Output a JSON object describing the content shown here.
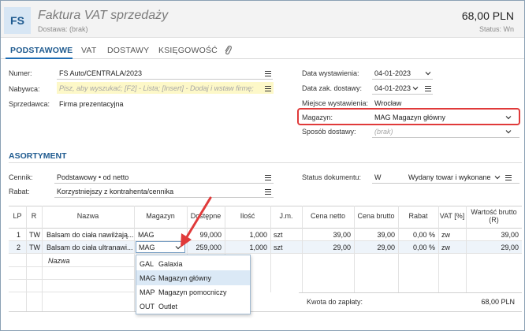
{
  "header": {
    "badge": "FS",
    "title": "Faktura VAT sprzedaży",
    "subtitle": "Dostawa: (brak)",
    "total": "68,00 PLN",
    "status": "Status: Wn"
  },
  "tabs": [
    {
      "label": "PODSTAWOWE",
      "active": true
    },
    {
      "label": "VAT"
    },
    {
      "label": "DOSTAWY"
    },
    {
      "label": "KSIĘGOWOŚĆ"
    }
  ],
  "form": {
    "numer_label": "Numer:",
    "numer_value": "FS Auto/CENTRALA/2023",
    "nabywca_label": "Nabywca:",
    "nabywca_placeholder": "Pisz, aby wyszukać; [F2] - Lista; [Insert] - Dodaj i wstaw firmę;",
    "sprzedawca_label": "Sprzedawca:",
    "sprzedawca_value": "Firma prezentacyjna",
    "data_wyst_label": "Data wystawienia:",
    "data_wyst_value": "04-01-2023",
    "data_zak_label": "Data zak. dostawy:",
    "data_zak_value": "04-01-2023",
    "miejsce_label": "Miejsce wystawienia:",
    "miejsce_value": "Wrocław",
    "magazyn_label": "Magazyn:",
    "magazyn_value": "MAG Magazyn główny",
    "sposob_label": "Sposób dostawy:",
    "sposob_value": "(brak)"
  },
  "asortyment": {
    "title": "ASORTYMENT",
    "cennik_label": "Cennik:",
    "cennik_value": "Podstawowy • od netto",
    "rabat_label": "Rabat:",
    "rabat_value": "Korzystniejszy z kontrahenta/cennika",
    "status_label": "Status dokumentu:",
    "status_code": "W",
    "status_value": "Wydany towar i wykonane"
  },
  "table": {
    "headers": [
      "LP",
      "R",
      "Nazwa",
      "Magazyn",
      "Dostępne",
      "Ilość",
      "J.m.",
      "Cena netto",
      "Cena brutto",
      "Rabat",
      "VAT [%]",
      "Wartość brutto (R)"
    ],
    "rows": [
      {
        "lp": "1",
        "r": "TW",
        "nazwa": "Balsam do ciała nawilżają...",
        "magazyn": "MAG",
        "dostepne": "99,000",
        "ilosc": "1,000",
        "jm": "szt",
        "netto": "39,00",
        "brutto": "39,00",
        "rabat": "0,00 %",
        "vat": "zw",
        "wartosc": "39,00"
      },
      {
        "lp": "2",
        "r": "TW",
        "nazwa": "Balsam do ciała ultranawi...",
        "magazyn": "MAG",
        "dostepne": "259,000",
        "ilosc": "1,000",
        "jm": "szt",
        "netto": "29,00",
        "brutto": "29,00",
        "rabat": "0,00 %",
        "vat": "zw",
        "wartosc": "29,00"
      }
    ],
    "new_row_placeholder": "Nazwa"
  },
  "dropdown": {
    "options": [
      {
        "code": "GAL",
        "name": "Galaxia"
      },
      {
        "code": "MAG",
        "name": "Magazyn główny",
        "selected": true
      },
      {
        "code": "MAP",
        "name": "Magazyn pomocniczy"
      },
      {
        "code": "OUT",
        "name": "Outlet"
      }
    ]
  },
  "summary": {
    "kwota_label": "Kwota do zapłaty:",
    "kwota_value": "68,00 PLN"
  },
  "colors": {
    "accent": "#1e5a8f",
    "highlight": "#e03a3a",
    "yellow_field": "#fdf8c8",
    "selected_row": "#dbe9f6"
  }
}
